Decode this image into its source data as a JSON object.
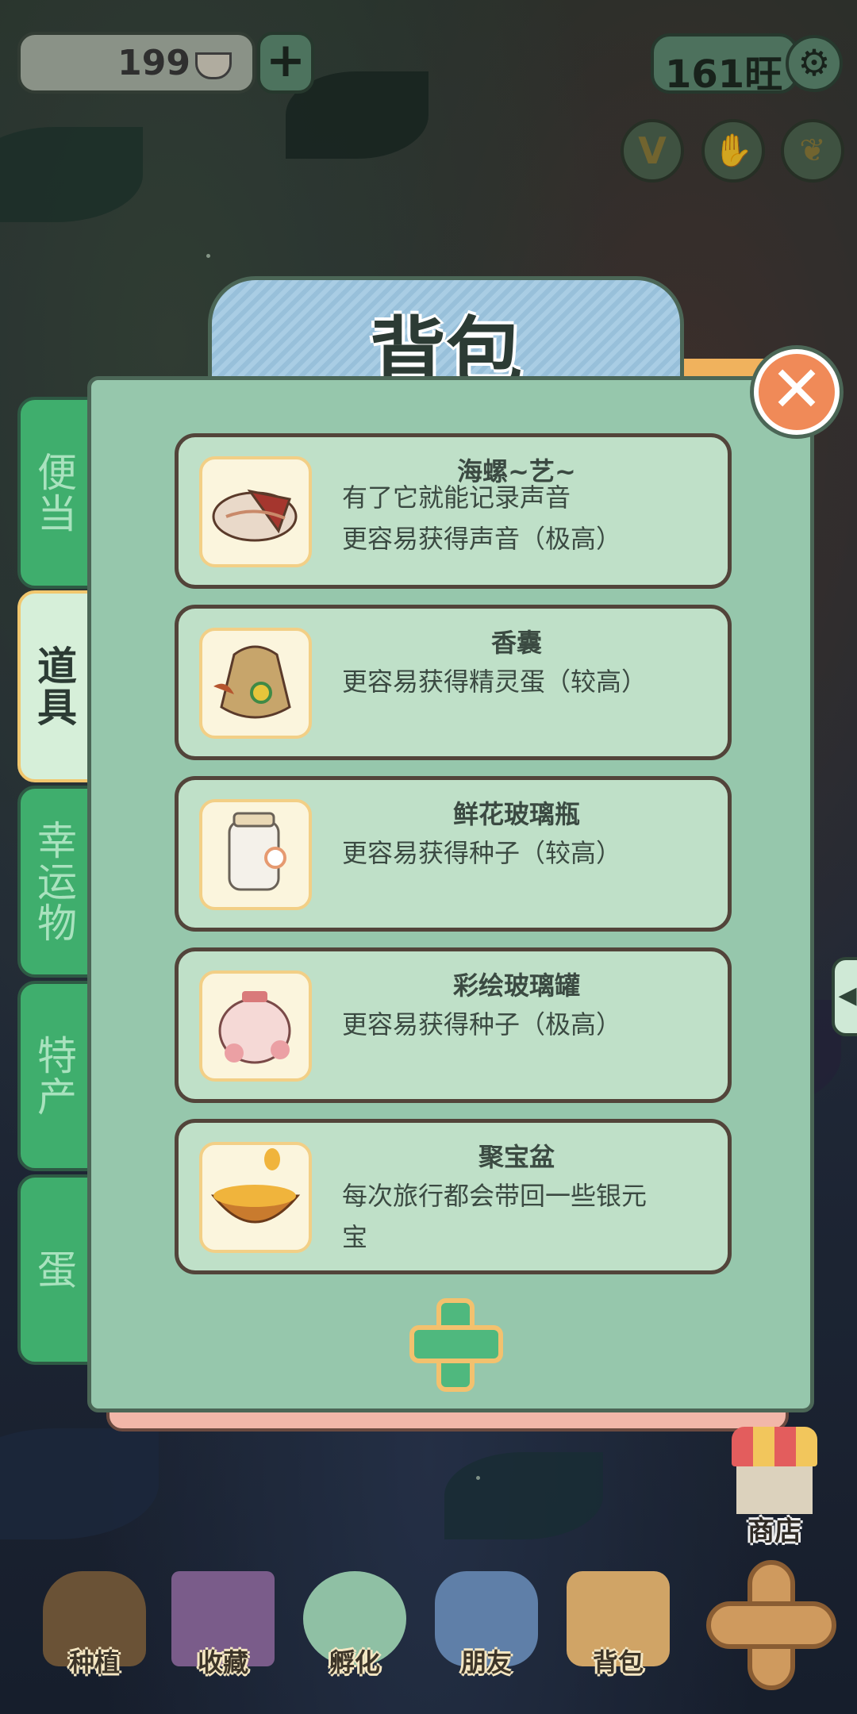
{
  "top_bar": {
    "coins": "199",
    "wang": "161旺"
  },
  "panel": {
    "title": "背包",
    "close_label": "✕",
    "side_tabs": [
      {
        "label": "便当",
        "active": false
      },
      {
        "label": "道具",
        "active": true
      },
      {
        "label": "幸运物",
        "active": false
      },
      {
        "label": "特产",
        "active": false
      },
      {
        "label": "蛋",
        "active": false
      }
    ],
    "items": [
      {
        "name": "海螺~艺~",
        "desc": "有了它就能记录声音\n更容易获得声音（极高）",
        "icon": "conch-shell-icon"
      },
      {
        "name": "香囊",
        "desc": "更容易获得精灵蛋（较高）",
        "icon": "sachet-pouch-icon"
      },
      {
        "name": "鲜花玻璃瓶",
        "desc": "更容易获得种子（较高）",
        "icon": "flower-glass-bottle-icon"
      },
      {
        "name": "彩绘玻璃罐",
        "desc": "更容易获得种子（极高）",
        "icon": "painted-glass-jar-icon"
      },
      {
        "name": "聚宝盆",
        "desc": "每次旅行都会带回一些银元\n宝",
        "icon": "treasure-bowl-icon"
      }
    ]
  },
  "shop_label": "商店",
  "bottom_nav": [
    {
      "label": "种植",
      "icon": "planting-icon"
    },
    {
      "label": "收藏",
      "icon": "collection-book-icon"
    },
    {
      "label": "孵化",
      "icon": "egg-hatch-icon"
    },
    {
      "label": "朋友",
      "icon": "friend-cat-icon"
    },
    {
      "label": "背包",
      "icon": "backpack-basket-icon"
    }
  ],
  "colors": {
    "panel_bg": "#96c7ac",
    "card_bg": "#bfe0c8",
    "tab_green": "#3fae6d",
    "close_orange": "#f08a58",
    "title_blue": "#a9cde4"
  }
}
